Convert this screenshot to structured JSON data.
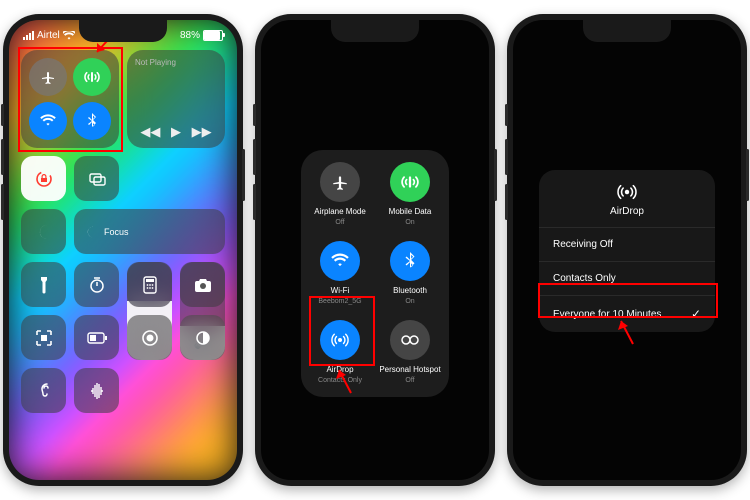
{
  "status": {
    "carrier": "Airtel",
    "battery_pct": "88%"
  },
  "p1": {
    "not_playing": "Not Playing",
    "focus": "Focus"
  },
  "p2": {
    "items": [
      {
        "label": "Airplane Mode",
        "sub": "Off"
      },
      {
        "label": "Mobile Data",
        "sub": "On"
      },
      {
        "label": "Wi-Fi",
        "sub": "Beebom2_5G"
      },
      {
        "label": "Bluetooth",
        "sub": "On"
      },
      {
        "label": "AirDrop",
        "sub": "Contacts Only"
      },
      {
        "label": "Personal Hotspot",
        "sub": "Off"
      }
    ]
  },
  "p3": {
    "title": "AirDrop",
    "options": [
      "Receiving Off",
      "Contacts Only",
      "Everyone for 10 Minutes"
    ],
    "selected": 2
  }
}
